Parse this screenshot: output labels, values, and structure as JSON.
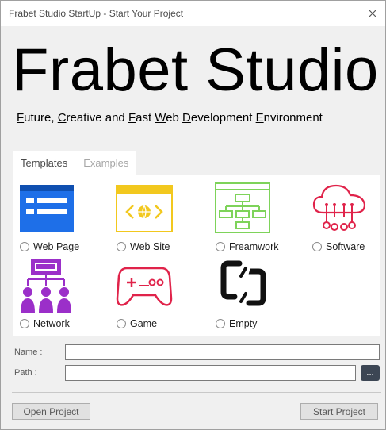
{
  "window": {
    "title": "Frabet Studio StartUp - Start Your Project"
  },
  "header": {
    "logo_text": "Frabet Studio",
    "tagline": [
      {
        "u": "F",
        "rest": "uture, "
      },
      {
        "u": "C",
        "rest": "reative and "
      },
      {
        "u": "F",
        "rest": "ast "
      },
      {
        "u": "W",
        "rest": "eb "
      },
      {
        "u": "D",
        "rest": "evelopment "
      },
      {
        "u": "E",
        "rest": "nvironment"
      }
    ]
  },
  "tabs": [
    {
      "label": "Templates",
      "active": true
    },
    {
      "label": "Examples",
      "active": false
    }
  ],
  "templates": [
    {
      "label": "Web Page",
      "icon": "web-page-icon",
      "color": "#1e6fe8"
    },
    {
      "label": "Web Site",
      "icon": "web-site-icon",
      "color": "#f2c81e"
    },
    {
      "label": "Freamwork",
      "icon": "framework-icon",
      "color": "#7ed35a"
    },
    {
      "label": "Software",
      "icon": "cloud-software-icon",
      "color": "#e0234a"
    },
    {
      "label": "Network",
      "icon": "network-icon",
      "color": "#9b2fc9"
    },
    {
      "label": "Game",
      "icon": "gamepad-icon",
      "color": "#e0234a"
    },
    {
      "label": "Empty",
      "icon": "empty-icon",
      "color": "#000000"
    }
  ],
  "form": {
    "name_label": "Name :",
    "name_value": "",
    "path_label": "Path :",
    "path_value": "",
    "browse_label": "..."
  },
  "buttons": {
    "open_project": "Open Project",
    "start_project": "Start Project"
  }
}
